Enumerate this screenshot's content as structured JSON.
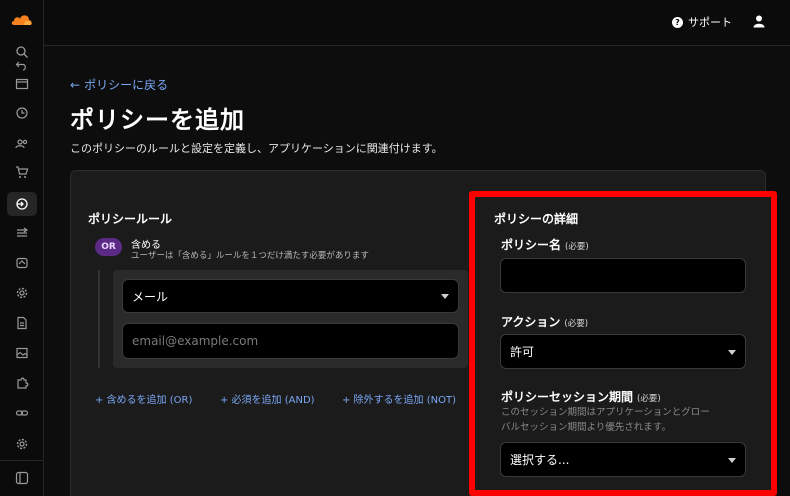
{
  "header": {
    "support_label": "サポート"
  },
  "page": {
    "back_link": "ポリシーに戻る",
    "title": "ポリシーを追加",
    "description": "このポリシーのルールと設定を定義し、アプリケーションに関連付けます。"
  },
  "rules": {
    "title": "ポリシールール",
    "badge": "OR",
    "include_label": "含める",
    "include_help": "ユーザーは「含める」ルールを１つだけ満たす必要があります",
    "selector_value": "メール",
    "email_placeholder": "email@example.com",
    "add_include": "+ 含めるを追加 (OR)",
    "add_require": "+ 必須を追加 (AND)",
    "add_exclude": "+ 除外するを追加 (NOT)"
  },
  "details": {
    "title": "ポリシーの詳細",
    "name_label": "ポリシー名",
    "required": "(必要)",
    "name_value": "",
    "action_label": "アクション",
    "action_value": "許可",
    "session_label": "ポリシーセッション期間",
    "session_help": "このセッション期間はアプリケーションとグローバルセッション期間より優先されます。",
    "session_value": "選択する..."
  },
  "colors": {
    "accent_link": "#7aa7f5",
    "highlight": "#ff0000",
    "badge_bg": "#5a2a85",
    "logo": "#f6821f"
  },
  "icons": [
    "cloudflare-logo",
    "search-icon",
    "undo-icon",
    "browser-icon",
    "clock-icon",
    "users-icon",
    "cart-icon",
    "access-icon",
    "gateway-icon",
    "network-icon",
    "settings-gear-icon",
    "document-icon",
    "image-icon",
    "puzzle-icon",
    "link-icon",
    "gear-icon",
    "panel-icon",
    "help-icon",
    "user-icon"
  ]
}
